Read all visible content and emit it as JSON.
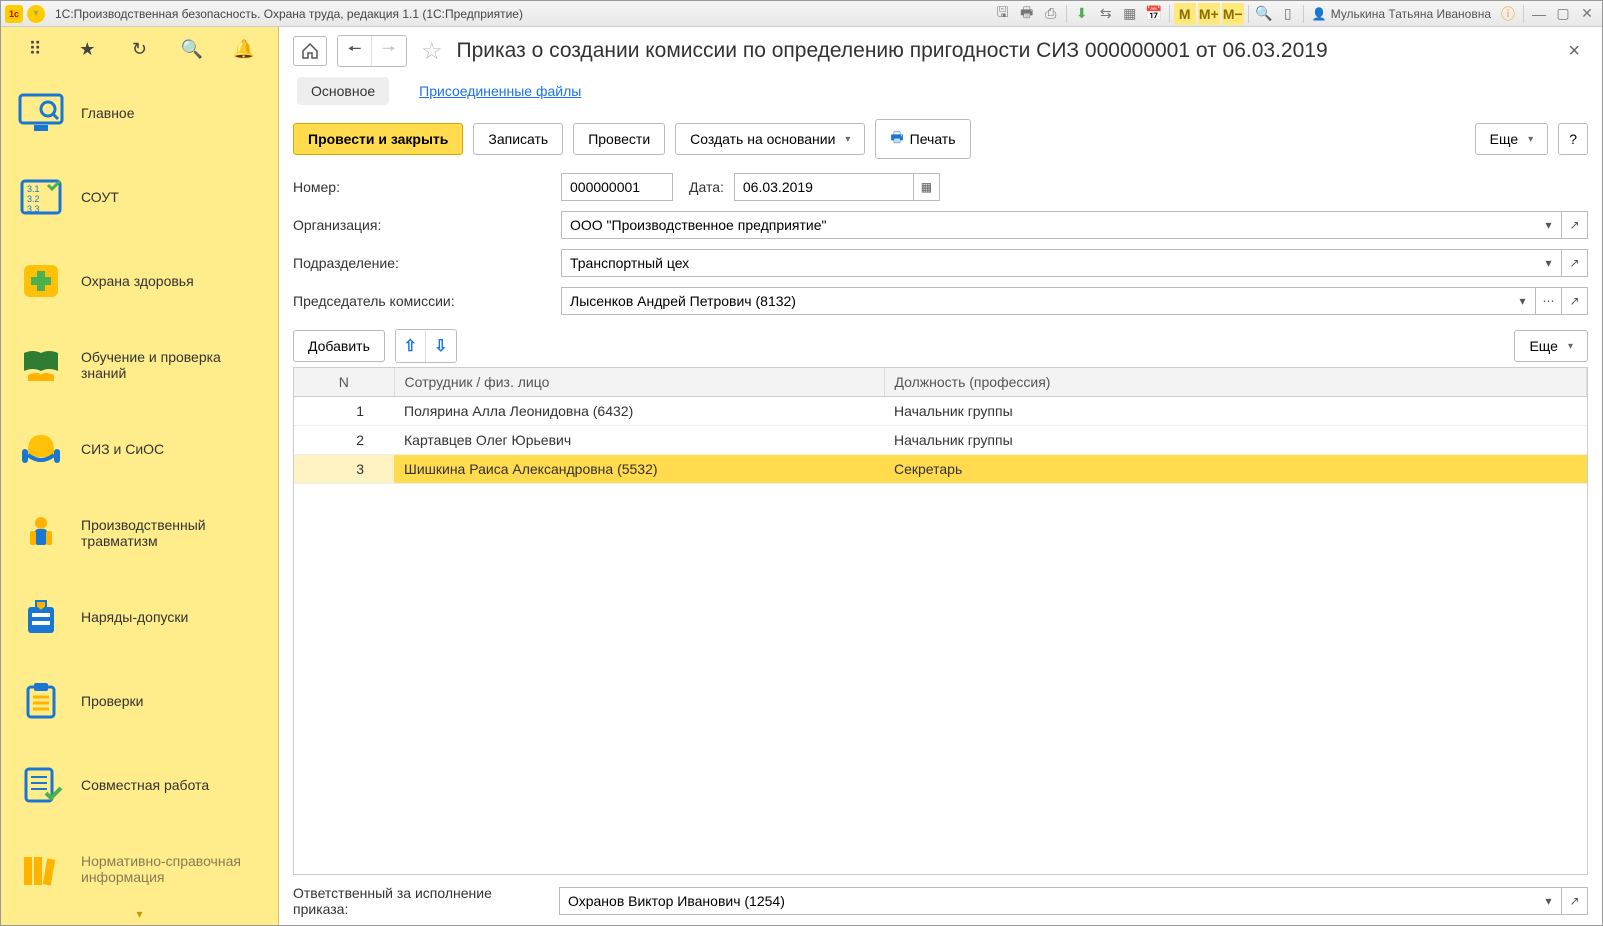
{
  "titlebar": {
    "title": "1С:Производственная безопасность. Охрана труда, редакция 1.1  (1С:Предприятие)",
    "user": "Мулькина Татьяна Ивановна"
  },
  "sidebar": {
    "items": [
      {
        "label": "Главное"
      },
      {
        "label": "СОУТ"
      },
      {
        "label": "Охрана здоровья"
      },
      {
        "label": "Обучение и проверка знаний"
      },
      {
        "label": "СИЗ и СиОС"
      },
      {
        "label": "Производственный травматизм"
      },
      {
        "label": "Наряды-допуски"
      },
      {
        "label": "Проверки"
      },
      {
        "label": "Совместная работа"
      },
      {
        "label": "Нормативно-справочная информация"
      }
    ]
  },
  "page": {
    "title": "Приказ о создании комиссии по определению пригодности СИЗ 000000001 от 06.03.2019",
    "tabs": {
      "main": "Основное",
      "files": "Присоединенные файлы"
    },
    "actions": {
      "post_close": "Провести и закрыть",
      "save": "Записать",
      "post": "Провести",
      "create_based": "Создать на основании",
      "print": "Печать",
      "more": "Еще",
      "help": "?"
    },
    "form": {
      "number_label": "Номер:",
      "number": "000000001",
      "date_label": "Дата:",
      "date": "06.03.2019",
      "org_label": "Организация:",
      "org": "ООО \"Производственное предприятие\"",
      "dept_label": "Подразделение:",
      "dept": "Транспортный цех",
      "chair_label": "Председатель комиссии:",
      "chair": "Лысенков Андрей Петрович (8132)"
    },
    "table_actions": {
      "add": "Добавить",
      "more": "Еще"
    },
    "table": {
      "cols": {
        "n": "N",
        "person": "Сотрудник / физ. лицо",
        "position": "Должность (профессия)"
      },
      "rows": [
        {
          "n": "1",
          "person": "Полярина Алла  Леонидовна (6432)",
          "position": "Начальник группы"
        },
        {
          "n": "2",
          "person": "Картавцев Олег Юрьевич",
          "position": "Начальник группы"
        },
        {
          "n": "3",
          "person": "Шишкина Раиса Александровна (5532)",
          "position": "Секретарь"
        }
      ]
    },
    "footer": {
      "resp_label": "Ответственный за исполнение приказа:",
      "resp": "Охранов Виктор Иванович (1254)"
    }
  }
}
